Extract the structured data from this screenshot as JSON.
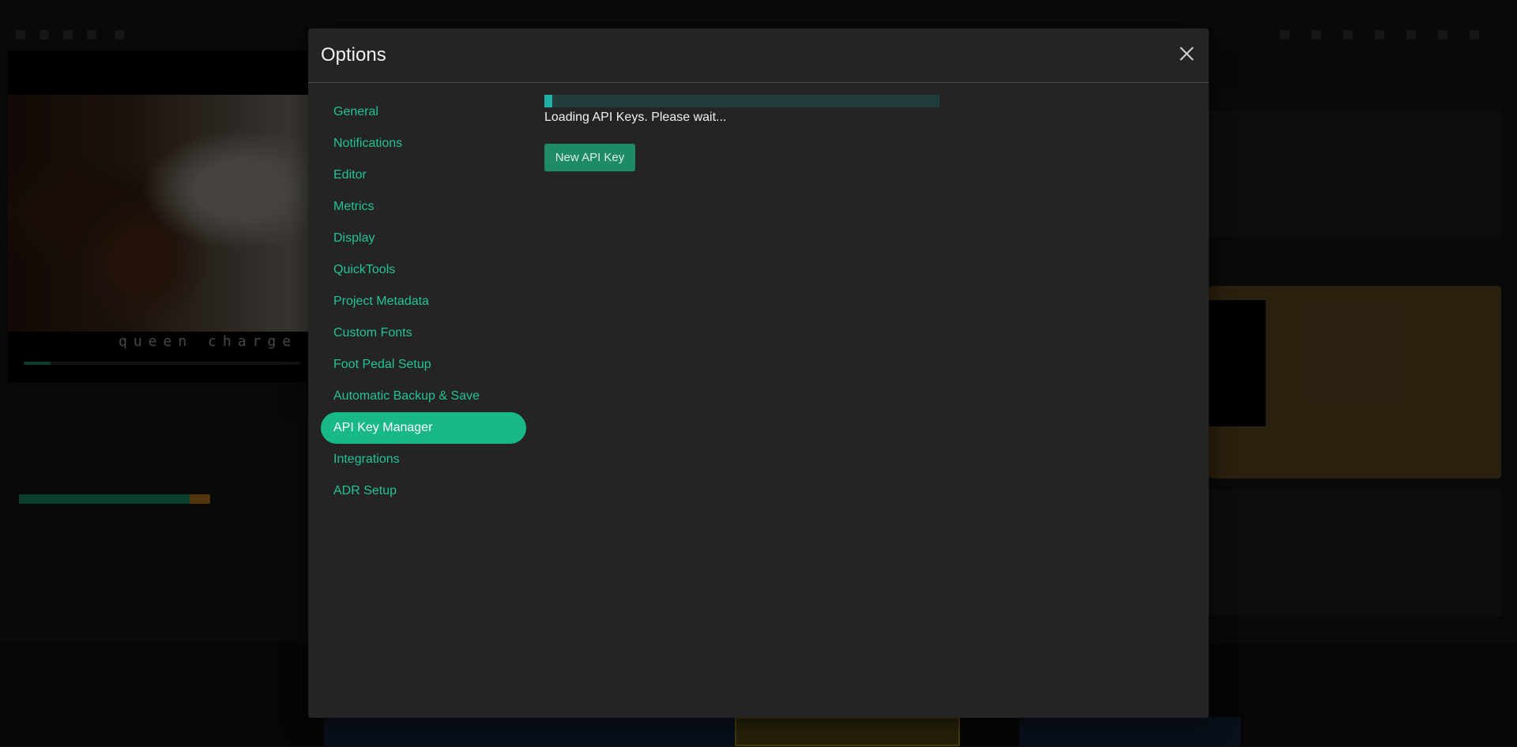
{
  "dialog": {
    "title": "Options",
    "close_icon": "close-icon"
  },
  "nav": {
    "active_index": 10,
    "items": [
      {
        "label": "General"
      },
      {
        "label": "Notifications"
      },
      {
        "label": "Editor"
      },
      {
        "label": "Metrics"
      },
      {
        "label": "Display"
      },
      {
        "label": "QuickTools"
      },
      {
        "label": "Project Metadata"
      },
      {
        "label": "Custom Fonts"
      },
      {
        "label": "Foot Pedal Setup"
      },
      {
        "label": "Automatic Backup & Save"
      },
      {
        "label": "API Key Manager"
      },
      {
        "label": "Integrations"
      },
      {
        "label": "ADR Setup"
      }
    ]
  },
  "api_keys": {
    "loading_progress": 0.02,
    "loading_text": "Loading API Keys. Please wait...",
    "new_key_label": "New API Key"
  },
  "colors": {
    "accent": "#18b887",
    "nav_link": "#22c396",
    "button": "#1f8a66",
    "progress_track": "#1f3d3d",
    "progress_fill": "#21b0a6",
    "dialog_bg": "#242424"
  }
}
